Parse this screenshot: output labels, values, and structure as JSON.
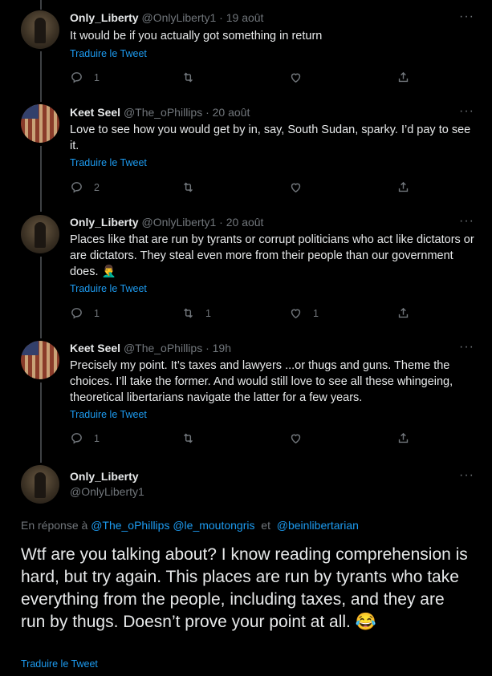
{
  "tweets": [
    {
      "name": "Only_Liberty",
      "handle": "@OnlyLiberty1 · 19 août",
      "text": "It would be if you actually got something in return",
      "translate": "Traduire le Tweet",
      "reply_count": "1",
      "retweet_count": "",
      "like_count": ""
    },
    {
      "name": "Keet Seel",
      "handle": "@The_oPhillips · 20 août",
      "text": "Love to see how you would get by in, say, South Sudan, sparky. I’d pay to see it.",
      "translate": "Traduire le Tweet",
      "reply_count": "2",
      "retweet_count": "",
      "like_count": ""
    },
    {
      "name": "Only_Liberty",
      "handle": "@OnlyLiberty1 · 20 août",
      "text": "Places like that are run by tyrants or corrupt politicians who act like dictators or are dictators. They steal even more from their people than our government does. 🤦‍♂️",
      "translate": "Traduire le Tweet",
      "reply_count": "1",
      "retweet_count": "1",
      "like_count": "1"
    },
    {
      "name": "Keet Seel",
      "handle": "@The_oPhillips · 19h",
      "text": "Precisely my point. It’s taxes and lawyers ...or thugs and guns. Theme the choices. I’ll take the former. And would still love to see all these whingeing, theoretical libertarians navigate the latter for a few years.",
      "translate": "Traduire le Tweet",
      "reply_count": "1",
      "retweet_count": "",
      "like_count": ""
    }
  ],
  "main": {
    "name": "Only_Liberty",
    "handle": "@OnlyLiberty1",
    "reply_prefix": "En réponse à",
    "mention1": "@The_oPhillips",
    "mention2": "@le_moutongris",
    "and": "et",
    "mention3": "@beinlibertarian",
    "text": "Wtf are you talking about? I know reading comprehension is hard, but try again. This places are run by tyrants who take everything from the people, including taxes, and they are run by thugs. Doesn’t prove your point at all. 😂",
    "translate": "Traduire le Tweet"
  },
  "icons": [
    "reply-icon",
    "retweet-icon",
    "like-icon",
    "share-icon",
    "more-icon"
  ],
  "colors": {
    "background": "#000000",
    "text": "#e7e9ea",
    "muted": "#71767b",
    "link": "#1d9bf0"
  }
}
